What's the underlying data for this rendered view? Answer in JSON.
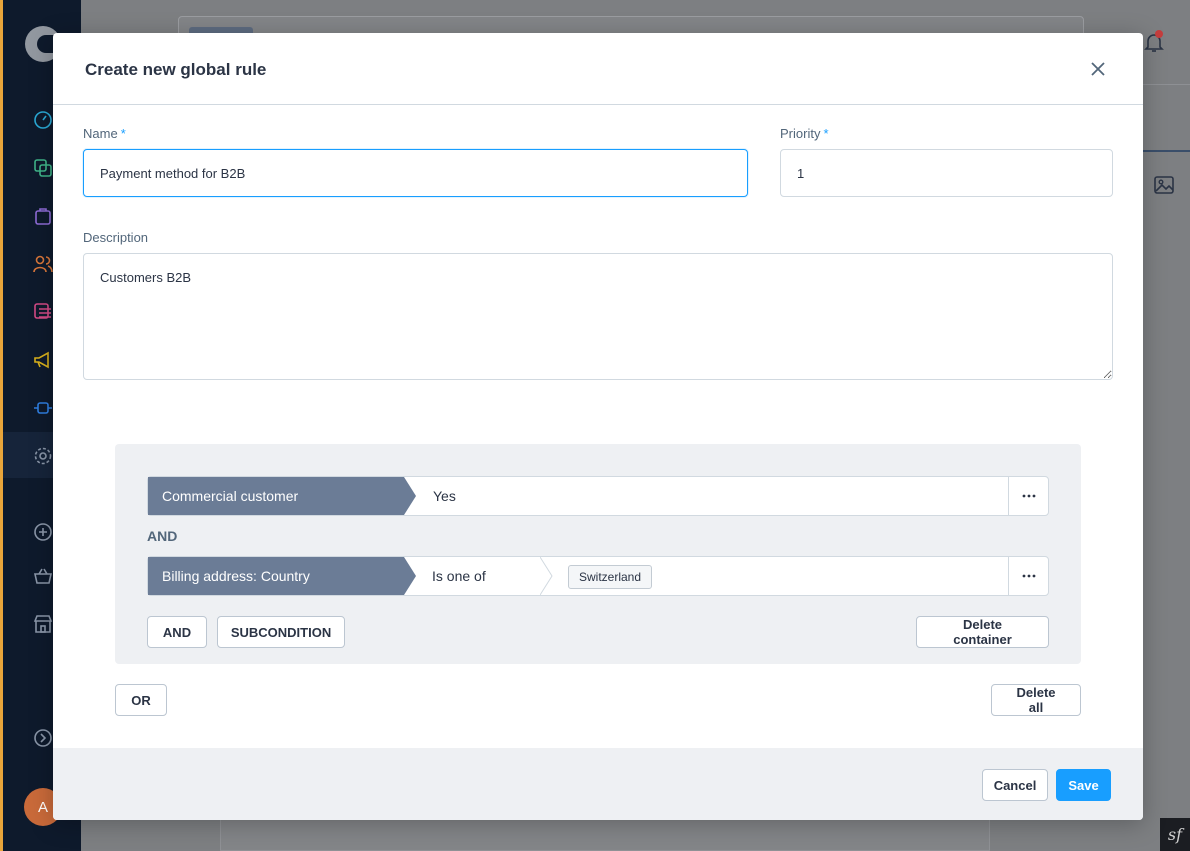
{
  "modal": {
    "title": "Create new global rule",
    "close_icon": "close-icon"
  },
  "form": {
    "name": {
      "label": "Name",
      "required_mark": "*",
      "value": "Payment method for B2B"
    },
    "priority": {
      "label": "Priority",
      "required_mark": "*",
      "value": "1"
    },
    "description": {
      "label": "Description",
      "value": "Customers B2B"
    }
  },
  "conditions": {
    "row1": {
      "type": "Commercial customer",
      "value": "Yes",
      "menu_icon": "more-icon"
    },
    "connector": "AND",
    "row2": {
      "type": "Billing address: Country",
      "operator": "Is one of",
      "tag": "Switzerland",
      "menu_icon": "more-icon"
    },
    "buttons": {
      "and": "AND",
      "subcondition": "SUBCONDITION",
      "delete_container": "Delete container"
    }
  },
  "actions": {
    "or": "OR",
    "delete_all": "Delete all"
  },
  "footer": {
    "cancel": "Cancel",
    "save": "Save"
  },
  "user": {
    "avatar_initial": "A"
  },
  "colors": {
    "primary": "#189eff",
    "condition_type": "#6b7c96",
    "sidebar_accent": "#e9a53a"
  }
}
